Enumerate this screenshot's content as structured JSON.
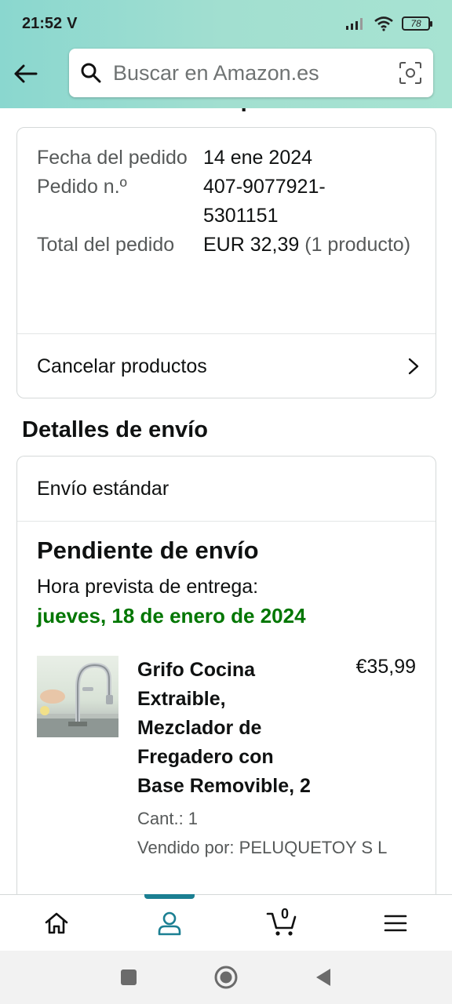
{
  "status_bar": {
    "time": "21:52",
    "carrier_glyph": "V",
    "battery": "78"
  },
  "search": {
    "placeholder": "Buscar en Amazon.es"
  },
  "page": {
    "heading": "Ver los detalles del pedido"
  },
  "order": {
    "date_label": "Fecha del pedido",
    "date_value": "14 ene 2024",
    "number_label": "Pedido n.º",
    "number_value": "407-9077921-5301151",
    "total_label": "Total del pedido",
    "total_value": "EUR 32,39",
    "total_items": "(1 producto)",
    "cancel_label": "Cancelar productos"
  },
  "shipping": {
    "title": "Detalles de envío",
    "method": "Envío estándar",
    "status": "Pendiente de envío",
    "delivery_label": "Hora prevista de entrega:",
    "delivery_date": "jueves, 18 de enero de 2024",
    "delivery_color": "#007600"
  },
  "product": {
    "title": "Grifo Cocina Extraible, Mezclador de Fregadero con Base Removible, 2",
    "price": "€35,99",
    "quantity": "Cant.: 1",
    "seller": "Vendido por: PELUQUETOY S L"
  },
  "bottom_nav": {
    "items": [
      "home-icon",
      "account-icon",
      "cart-icon",
      "menu-icon"
    ],
    "cart_count": "0",
    "active_color": "#1b7f92"
  },
  "system_nav": {
    "items": [
      "recents-icon",
      "home-circle-icon",
      "back-triangle-icon"
    ]
  }
}
